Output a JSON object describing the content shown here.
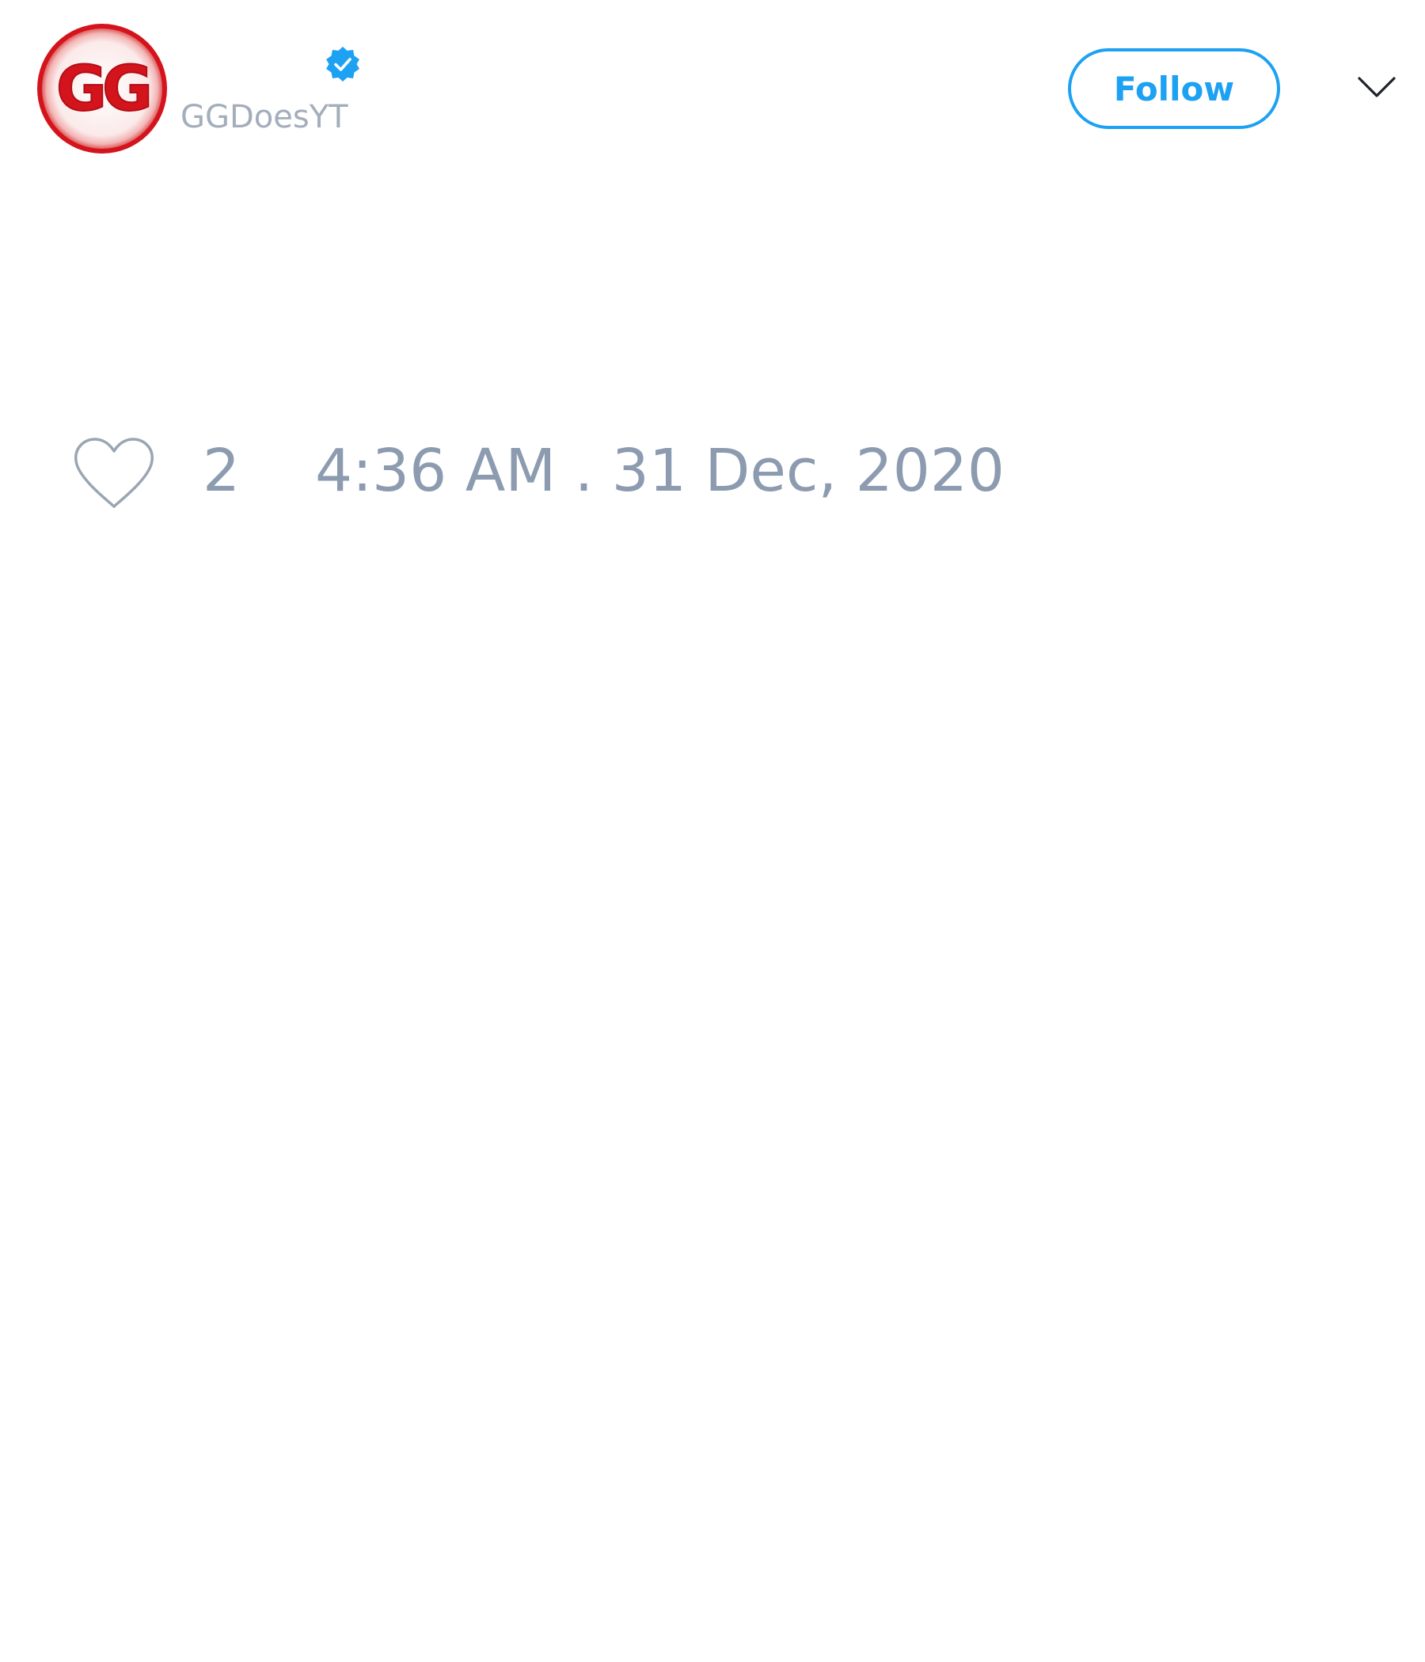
{
  "author": {
    "avatar_label": "GG",
    "handle": "GGDoesYT",
    "verified": true
  },
  "header": {
    "follow_label": "Follow",
    "menu_icon": "chevron-down-icon"
  },
  "actions": {
    "like_icon": "heart-icon",
    "like_count": "2",
    "timestamp": "4:36 AM . 31 Dec, 2020"
  },
  "colors": {
    "accent": "#1da1f2",
    "muted_text": "#8c9bb0",
    "avatar_red": "#d4141c"
  }
}
